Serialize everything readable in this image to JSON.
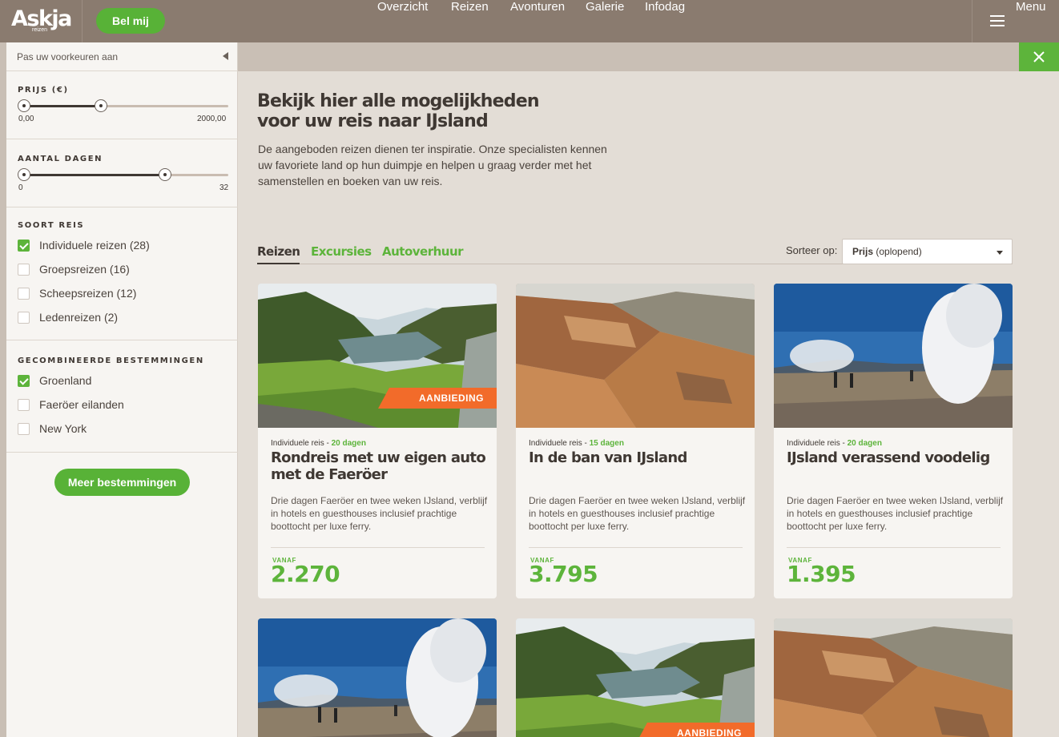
{
  "header": {
    "logo": "Askja",
    "logo_sub": "reizen",
    "call_button": "Bel mij",
    "nav": [
      "Overzicht",
      "Reizen",
      "Avonturen",
      "Galerie",
      "Infodag"
    ],
    "menu_label": "Menu"
  },
  "sidebar": {
    "header_label": "Pas uw voorkeuren aan",
    "price": {
      "title": "PRIJS (€)",
      "min_label": "0,00",
      "max_label": "2000,00",
      "selected_fraction": 0.375
    },
    "days": {
      "title": "AANTAL DAGEN",
      "min_label": "0",
      "max_label": "32",
      "selected_fraction": 0.69
    },
    "trip_type": {
      "title": "SOORT REIS",
      "options": [
        {
          "label": "Individuele reizen (28)",
          "checked": true
        },
        {
          "label": "Groepsreizen (16)",
          "checked": false
        },
        {
          "label": "Scheepsreizen (12)",
          "checked": false
        },
        {
          "label": "Ledenreizen (2)",
          "checked": false
        }
      ]
    },
    "destinations": {
      "title": "GECOMBINEERDE BESTEMMINGEN",
      "options": [
        {
          "label": "Groenland",
          "checked": true
        },
        {
          "label": "Faeröer eilanden",
          "checked": false
        },
        {
          "label": "New York",
          "checked": false
        }
      ]
    },
    "more_button": "Meer bestemmingen"
  },
  "main": {
    "title_line1": "Bekijk hier alle mogelijkheden",
    "title_line2": "voor uw reis naar IJsland",
    "intro": "De aangeboden reizen dienen ter inspiratie. Onze specialisten kennen uw favoriete land op hun duimpje en helpen u graag verder met het samenstellen en boeken van uw reis.",
    "tabs": [
      {
        "label": "Reizen",
        "active": true
      },
      {
        "label": "Excursies",
        "active": false
      },
      {
        "label": "Autoverhuur",
        "active": false
      }
    ],
    "sort_label": "Sorteer op:",
    "sort_value_bold": "Prijs",
    "sort_value_rest": " (oplopend)",
    "cards": [
      {
        "image": "fjord",
        "badge": "AANBIEDING",
        "type": "Individuele reis - ",
        "days": "20 dagen",
        "title": "Rondreis met uw eigen auto met de Faeröer",
        "desc": "Drie dagen Faeröer en twee weken IJsland, verblijf in hotels en guesthouses inclusief prachtige boottocht per luxe ferry.",
        "price_prefix": "VANAF",
        "price": "2.270"
      },
      {
        "image": "mountains",
        "badge": "",
        "type": "Individuele reis - ",
        "days": "15 dagen",
        "title": "In de ban van IJsland",
        "desc": "Drie dagen Faeröer en twee weken IJsland, verblijf in hotels en guesthouses inclusief prachtige boottocht per luxe ferry.",
        "price_prefix": "VANAF",
        "price": "3.795"
      },
      {
        "image": "geyser",
        "badge": "",
        "type": "Individuele reis - ",
        "days": "20 dagen",
        "title": "IJsland verassend voodelig",
        "desc": "Drie dagen Faeröer en twee weken IJsland, verblijf in hotels en guesthouses inclusief prachtige boottocht per luxe ferry.",
        "price_prefix": "VANAF",
        "price": "1.395"
      },
      {
        "image": "geyser",
        "badge": ""
      },
      {
        "image": "fjord",
        "badge": "AANBIEDING"
      },
      {
        "image": "mountains",
        "badge": ""
      }
    ]
  },
  "colors": {
    "brand_green": "#5db43b",
    "header_brown": "#8a7b6f",
    "offer_orange": "#f26b2a"
  }
}
